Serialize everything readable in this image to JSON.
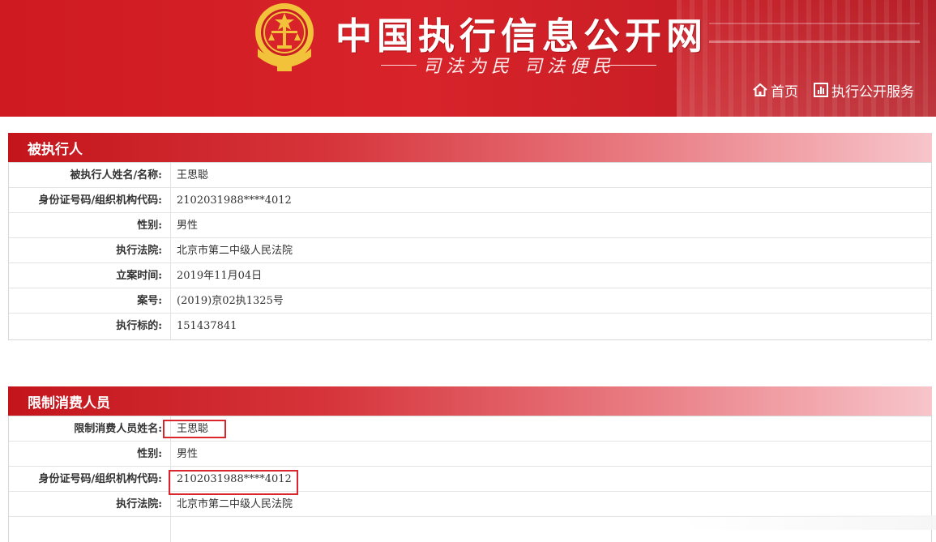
{
  "header": {
    "site_title": "中国执行信息公开网",
    "slogan": "司法为民  司法便民",
    "nav": [
      {
        "label": "首页",
        "icon": "home-icon"
      },
      {
        "label": "执行公开服务",
        "icon": "chart-icon"
      }
    ],
    "colors": {
      "brand_red": "#d8232a",
      "accent_gold": "#f2c23b"
    }
  },
  "section1": {
    "title": "被执行人",
    "rows": [
      {
        "label": "被执行人姓名/名称:",
        "value": "王思聪"
      },
      {
        "label": "身份证号码/组织机构代码:",
        "value": "2102031988****4012"
      },
      {
        "label": "性别:",
        "value": "男性"
      },
      {
        "label": "执行法院:",
        "value": "北京市第二中级人民法院"
      },
      {
        "label": "立案时间:",
        "value": "2019年11月04日"
      },
      {
        "label": "案号:",
        "value": "(2019)京02执1325号"
      },
      {
        "label": "执行标的:",
        "value": "151437841"
      }
    ]
  },
  "section2": {
    "title": "限制消费人员",
    "rows": [
      {
        "label": "限制消费人员姓名:",
        "value": "王思聪"
      },
      {
        "label": "性别:",
        "value": "男性"
      },
      {
        "label": "身份证号码/组织机构代码:",
        "value": "2102031988****4012"
      },
      {
        "label": "执行法院:",
        "value": "北京市第二中级人民法院"
      }
    ]
  }
}
